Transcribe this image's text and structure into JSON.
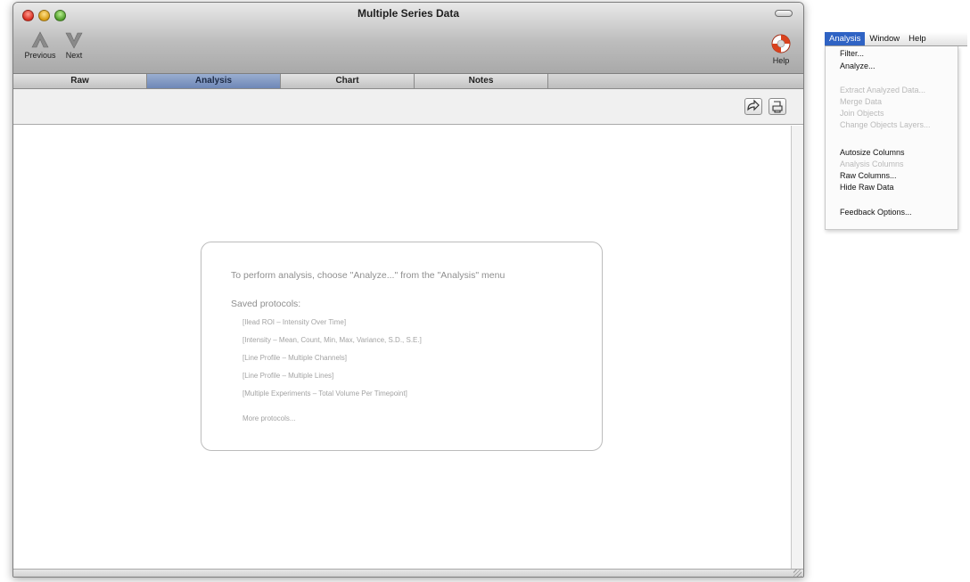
{
  "window": {
    "title": "Multiple Series Data",
    "toolbar": {
      "previous_label": "Previous",
      "next_label": "Next",
      "help_label": "Help"
    }
  },
  "tabs": [
    {
      "label": "Raw",
      "active": false
    },
    {
      "label": "Analysis",
      "active": true
    },
    {
      "label": "Chart",
      "active": false
    },
    {
      "label": "Notes",
      "active": false
    }
  ],
  "content": {
    "instruction": "To perform analysis, choose \"Analyze...\" from the \"Analysis\" menu",
    "saved_label": "Saved protocols:",
    "protocols": [
      "[Ilead ROI – Intensity Over Time]",
      "[Intensity – Mean, Count, Min, Max, Variance, S.D., S.E.]",
      "[Line Profile – Multiple Channels]",
      "[Line Profile – Multiple Lines]",
      "[Multiple Experiments – Total Volume Per Timepoint]"
    ],
    "more_protocols": "More protocols..."
  },
  "menubar": {
    "items": [
      {
        "label": "Analysis",
        "active": true
      },
      {
        "label": "Window",
        "active": false
      },
      {
        "label": "Help",
        "active": false
      }
    ]
  },
  "analysis_menu": {
    "items": [
      {
        "label": "Filter...",
        "enabled": true
      },
      {
        "label": "Analyze...",
        "enabled": true
      },
      {
        "label": "Extract Analyzed Data...",
        "enabled": false
      },
      {
        "label": "Merge Data",
        "enabled": false
      },
      {
        "label": "Join Objects",
        "enabled": false
      },
      {
        "label": "Change Objects Layers...",
        "enabled": false
      },
      {
        "label": "Autosize Columns",
        "enabled": true
      },
      {
        "label": "Analysis Columns",
        "enabled": false
      },
      {
        "label": "Raw Columns...",
        "enabled": true
      },
      {
        "label": "Hide Raw Data",
        "enabled": true
      },
      {
        "label": "Feedback Options...",
        "enabled": true
      }
    ]
  },
  "colors": {
    "active_tab": "#7f94bf",
    "menu_highlight": "#2f63c4",
    "help_icon": "#d9421e"
  },
  "icons": {
    "previous": "up-arrow-icon",
    "next": "down-arrow-icon",
    "help": "lifebuoy-icon",
    "export": "export-arrow-icon",
    "print": "print-icon"
  }
}
